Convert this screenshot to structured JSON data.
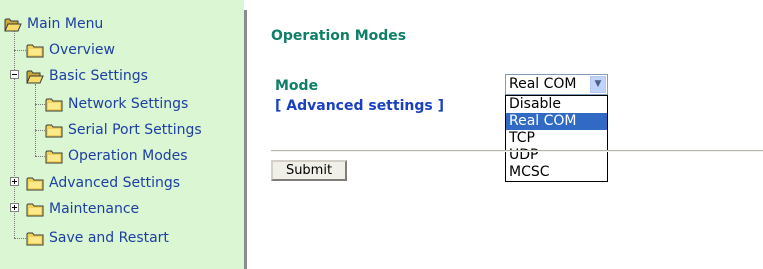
{
  "nav": {
    "root": "Main Menu",
    "items": [
      {
        "label": "Overview"
      },
      {
        "label": "Basic Settings"
      },
      {
        "label": "Network Settings"
      },
      {
        "label": "Serial Port Settings"
      },
      {
        "label": "Operation Modes"
      },
      {
        "label": "Advanced Settings"
      },
      {
        "label": "Maintenance"
      },
      {
        "label": "Save and Restart"
      }
    ]
  },
  "page": {
    "title": "Operation Modes",
    "mode_label": "Mode",
    "advanced_link": "[ Advanced settings ]",
    "submit_label": "Submit"
  },
  "mode_select": {
    "value": "Real COM",
    "options": [
      "Disable",
      "Real COM",
      "TCP",
      "UDP",
      "MCSC"
    ],
    "selected_index": 1
  },
  "colors": {
    "sidebar_bg": "#daf6d2",
    "nav_text": "#1d3fa3",
    "heading_text": "#0f7f68",
    "link_text": "#1a3fc0",
    "highlight": "#316ac5",
    "folder": "#f2d25a"
  }
}
